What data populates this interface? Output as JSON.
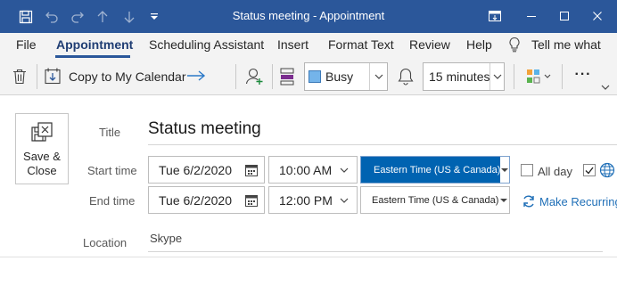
{
  "window": {
    "title": "Status meeting  -  Appointment"
  },
  "menu": {
    "file": "File",
    "appointment": "Appointment",
    "scheduling": "Scheduling Assistant",
    "insert": "Insert",
    "format_text": "Format Text",
    "review": "Review",
    "help": "Help",
    "tell_me": "Tell me what"
  },
  "toolbar": {
    "copy_label": "Copy to My Calendar",
    "show_as": "Busy",
    "reminder": "15 minutes",
    "more": "···"
  },
  "form": {
    "save_line1": "Save &",
    "save_line2": "Close",
    "title_label": "Title",
    "title_value": "Status meeting",
    "start_label": "Start time",
    "start_date": "Tue 6/2/2020",
    "start_time": "10:00 AM",
    "start_tz": "Eastern Time (US & Canada)",
    "allday_label": "All day",
    "end_label": "End time",
    "end_date": "Tue 6/2/2020",
    "end_time": "12:00 PM",
    "end_tz": "Eastern Time (US & Canada)",
    "recurring_label": "Make Recurring",
    "location_label": "Location",
    "location_value": "Skype"
  },
  "colors": {
    "brand": "#2b579a",
    "busy_swatch": "#74b4ea",
    "selection": "#0063b1",
    "recurring": "#1f6fb7"
  },
  "icons": [
    "save-icon",
    "undo-icon",
    "redo-icon",
    "up-arrow-icon",
    "down-arrow-icon",
    "customize-qat-icon",
    "ribbon-display-icon",
    "minimize-icon",
    "maximize-icon",
    "close-icon",
    "lightbulb-icon",
    "delete-icon",
    "copy-calendar-icon",
    "arrow-right-icon",
    "invite-attendees-icon",
    "show-as-icon",
    "bell-icon",
    "categorize-icon",
    "more-icon",
    "collapse-ribbon-icon",
    "save-close-icon",
    "calendar-icon",
    "checkbox-icon",
    "globe-icon",
    "recurrence-icon"
  ]
}
